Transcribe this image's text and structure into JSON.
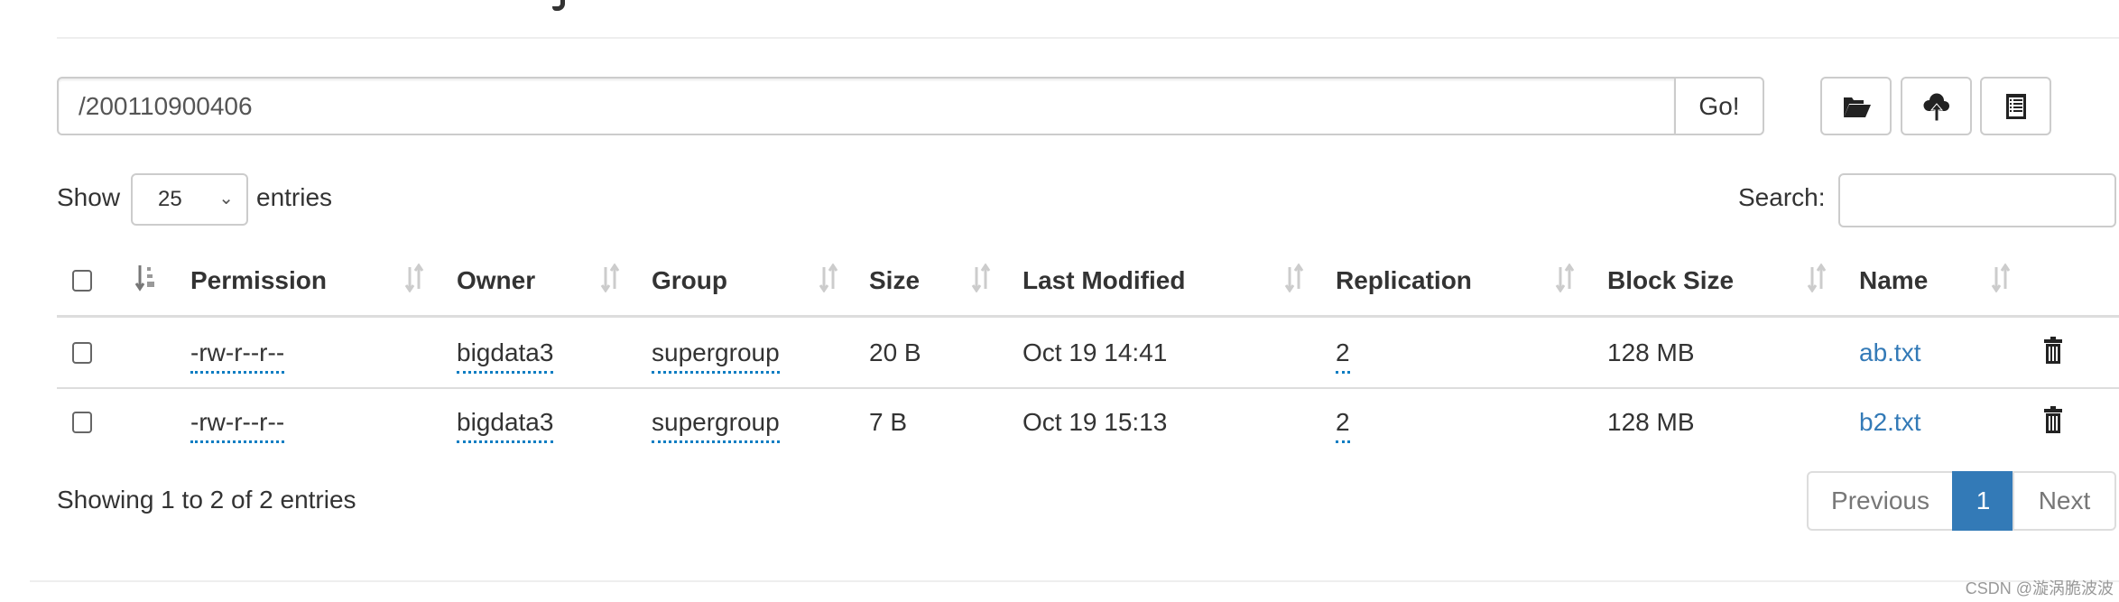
{
  "toolbar": {
    "path_value": "/200110900406",
    "go_label": "Go!",
    "buttons": [
      {
        "icon": "folder-open-icon"
      },
      {
        "icon": "cloud-upload-icon"
      },
      {
        "icon": "list-alt-icon"
      }
    ]
  },
  "length_control": {
    "show_label": "Show",
    "selected": "25",
    "entries_label": "entries"
  },
  "search": {
    "label": "Search:",
    "value": ""
  },
  "table": {
    "columns": [
      "Permission",
      "Owner",
      "Group",
      "Size",
      "Last Modified",
      "Replication",
      "Block Size",
      "Name"
    ],
    "rows": [
      {
        "permission": "-rw-r--r--",
        "owner": "bigdata3",
        "group": "supergroup",
        "size": "20 B",
        "modified": "Oct 19 14:41",
        "replication": "2",
        "block_size": "128 MB",
        "name": "ab.txt"
      },
      {
        "permission": "-rw-r--r--",
        "owner": "bigdata3",
        "group": "supergroup",
        "size": "7 B",
        "modified": "Oct 19 15:13",
        "replication": "2",
        "block_size": "128 MB",
        "name": "b2.txt"
      }
    ]
  },
  "footer": {
    "info": "Showing 1 to 2 of 2 entries",
    "pagination": {
      "previous": "Previous",
      "current": "1",
      "next": "Next"
    }
  },
  "watermark": "CSDN @漩涡脆波波",
  "colors": {
    "accent": "#337ab7",
    "link": "#337ab7",
    "dotted_underline": "#0b7dc2"
  }
}
